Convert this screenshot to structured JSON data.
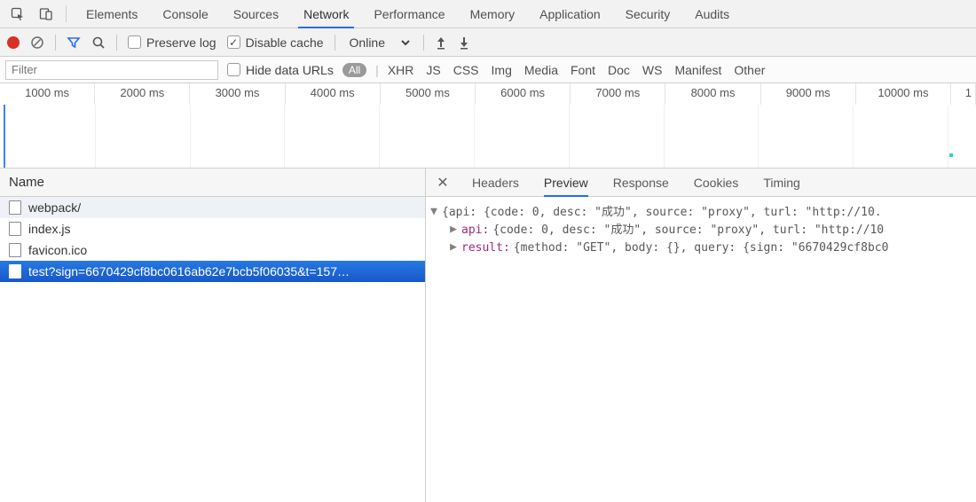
{
  "menubar": {
    "tabs": [
      "Elements",
      "Console",
      "Sources",
      "Network",
      "Performance",
      "Memory",
      "Application",
      "Security",
      "Audits"
    ],
    "active": 3
  },
  "toolbar": {
    "preserve_log_label": "Preserve log",
    "preserve_log_checked": false,
    "disable_cache_label": "Disable cache",
    "disable_cache_checked": true,
    "throttle_value": "Online"
  },
  "filterbar": {
    "filter_placeholder": "Filter",
    "hide_data_urls_label": "Hide data URLs",
    "hide_data_urls_checked": false,
    "all_chip": "All",
    "types": [
      "XHR",
      "JS",
      "CSS",
      "Img",
      "Media",
      "Font",
      "Doc",
      "WS",
      "Manifest",
      "Other"
    ]
  },
  "timeline": {
    "ticks_ms": [
      1000,
      2000,
      3000,
      4000,
      5000,
      6000,
      7000,
      8000,
      9000,
      10000
    ],
    "unit_suffix": " ms",
    "trailing_label": "1"
  },
  "requests": {
    "header": "Name",
    "rows": [
      {
        "label": "webpack/",
        "selected": false,
        "striped": true
      },
      {
        "label": "index.js",
        "selected": false,
        "striped": false
      },
      {
        "label": "favicon.ico",
        "selected": false,
        "striped": false
      },
      {
        "label": "test?sign=6670429cf8bc0616ab62e7bcb5f06035&t=157…",
        "selected": true,
        "striped": false
      }
    ]
  },
  "detail": {
    "tabs": [
      "Headers",
      "Preview",
      "Response",
      "Cookies",
      "Timing"
    ],
    "active": 1,
    "preview_tree": {
      "root_label": "{api: {code: 0, desc: \"成功\", source: \"proxy\", turl: \"http://10.",
      "children": [
        {
          "key": "api",
          "value": "{code: 0, desc: \"成功\", source: \"proxy\", turl: \"http://10"
        },
        {
          "key": "result",
          "value": "{method: \"GET\", body: {}, query: {sign: \"6670429cf8bc0"
        }
      ]
    }
  }
}
